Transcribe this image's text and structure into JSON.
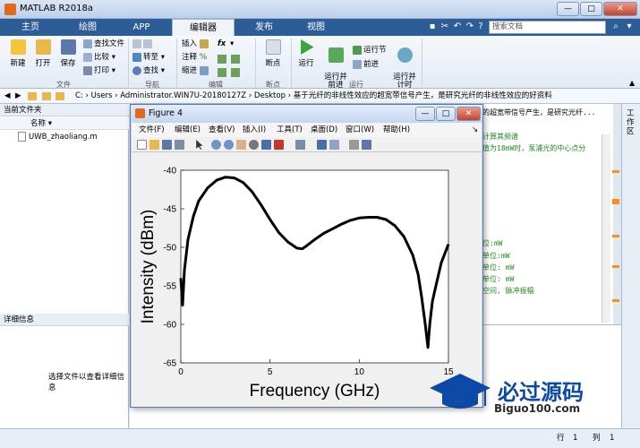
{
  "app": {
    "title": "MATLAB R2018a"
  },
  "ribbon_tabs": [
    "主页",
    "绘图",
    "APP",
    "编辑器",
    "发布",
    "视图"
  ],
  "search_placeholder": "搜索文档",
  "ribbon": {
    "file_group": {
      "label": "文件",
      "new": "新建",
      "open": "打开",
      "save": "保存",
      "find_files": "查找文件",
      "compare": "比较",
      "print": "打印"
    },
    "nav_group": {
      "label": "导航",
      "goto": "转至",
      "find": "查找"
    },
    "edit_group": {
      "label": "编辑",
      "insert": "插入",
      "comment": "注释",
      "indent": "缩进",
      "fx": "fx"
    },
    "breakpoints_group": {
      "label": "断点",
      "breakpoints": "断点"
    },
    "run_group": {
      "label": "运行",
      "run": "运行",
      "run_advance": "运行并\n前进",
      "run_section": "运行节",
      "advance": "前进",
      "run_time": "运行并\n计时"
    }
  },
  "address_path": "C: › Users › Administrator.WIN7U-20180127Z › Desktop › 基于光纤的非线性效应的超宽带信号产生，是研究光纤的非线性效应的好资料",
  "left_pane": {
    "header": "当前文件夹",
    "col_name": "名称",
    "files": [
      "UWB_zhaoliang.m"
    ],
    "details_header": "详细信息",
    "details_hint": "选择文件以查看详细信息"
  },
  "editor_snippets": [
    "的超宽带信号产生，是研究光纤...",
    "计算其频谱",
    "值为18mW时，泵浦光的中心点分",
    "位:mW",
    "单位:mW",
    "单位: mW",
    "单位: mW",
    "空间, 脉冲振幅"
  ],
  "right_sidebar": "工作区",
  "statusbar": {
    "row_label": "行",
    "row": "1",
    "col_label": "列",
    "col": "1"
  },
  "figure": {
    "title": "Figure 4",
    "menu": [
      "文件(F)",
      "编辑(E)",
      "查看(V)",
      "插入(I)",
      "工具(T)",
      "桌面(D)",
      "窗口(W)",
      "帮助(H)"
    ]
  },
  "chart_data": {
    "type": "line",
    "xlabel": "Frequency (GHz)",
    "ylabel": "Intensity (dBm)",
    "xlim": [
      0,
      15
    ],
    "ylim": [
      -65,
      -40
    ],
    "xticks": [
      0,
      5,
      10,
      15
    ],
    "yticks": [
      -40,
      -45,
      -50,
      -55,
      -60,
      -65
    ],
    "grid": false,
    "series": [
      {
        "color": "#000000",
        "x": [
          0,
          0.1,
          0.2,
          0.4,
          0.7,
          1.0,
          1.5,
          2.0,
          2.5,
          3.0,
          3.5,
          4.0,
          4.5,
          5.0,
          5.5,
          6.0,
          6.5,
          6.8,
          7.0,
          7.5,
          8.0,
          8.5,
          9.0,
          9.5,
          10.0,
          10.5,
          11.0,
          11.5,
          12.0,
          12.5,
          13.0,
          13.3,
          13.5,
          13.7,
          13.85,
          13.95,
          14.1,
          14.3,
          14.6,
          15.0
        ],
        "y": [
          -54.0,
          -57.5,
          -53.0,
          -49.0,
          -46.0,
          -44.0,
          -42.3,
          -41.3,
          -40.9,
          -41.0,
          -41.6,
          -42.8,
          -44.5,
          -46.4,
          -48.1,
          -49.3,
          -50.1,
          -50.2,
          -49.9,
          -49.0,
          -48.2,
          -47.6,
          -47.0,
          -46.5,
          -46.2,
          -46.1,
          -46.1,
          -46.4,
          -47.2,
          -48.6,
          -51.0,
          -53.5,
          -56.5,
          -60.0,
          -63.0,
          -60.0,
          -57.0,
          -55.0,
          -52.0,
          -49.6
        ]
      }
    ]
  },
  "watermark": {
    "text": "必过源码",
    "sub": "Biguo100.com"
  },
  "colors": {
    "ribbon_tab_bar": "#2c5d96",
    "accent_orange": "#ff8c1a",
    "code_green": "#228b22",
    "watermark_blue": "#0d4aa8"
  }
}
